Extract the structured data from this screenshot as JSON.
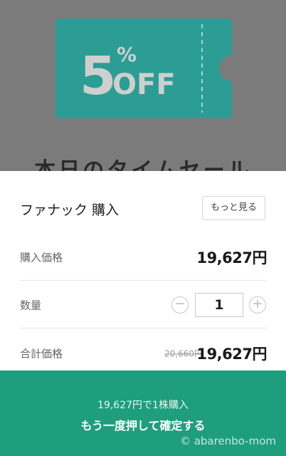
{
  "colors": {
    "backdrop": "#7b7b7b",
    "coupon": "#1fa39a",
    "confirm_bar": "#1e9e7c"
  },
  "banner": {
    "discount_number": "5",
    "discount_percent": "%",
    "discount_off": "OFF",
    "behind_title": "本日のタイムセール"
  },
  "sheet": {
    "title": "ファナック 購入",
    "more_button": "もっと見る",
    "purchase_price": {
      "label": "購入価格",
      "value": "19,627円"
    },
    "quantity": {
      "label": "数量",
      "value": "1"
    },
    "total_price": {
      "label": "合計価格",
      "original": "20,660円",
      "value": "19,627円"
    }
  },
  "confirm": {
    "summary": "19,627円で1株購入",
    "action": "もう一度押して確定する"
  },
  "watermark": "© abarenbo-mom"
}
